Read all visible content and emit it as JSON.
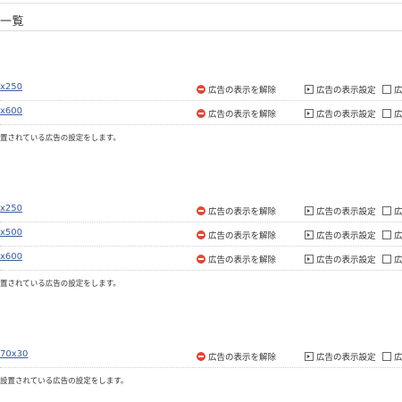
{
  "page": {
    "title": "一覧"
  },
  "actions": {
    "remove_label": "広告の表示を解除",
    "settings_label": "広告の表示設定",
    "more_label": "広告"
  },
  "groups": [
    {
      "rows": [
        {
          "size": "x250"
        },
        {
          "size": "x600"
        }
      ],
      "note": "置されている広告の設定をします。"
    },
    {
      "rows": [
        {
          "size": "x250"
        },
        {
          "size": "x500"
        },
        {
          "size": "x600"
        }
      ],
      "note": "置されている広告の設定をします。"
    },
    {
      "rows": [
        {
          "size": "70x30"
        }
      ],
      "note": "設置されている広告の設定をします。"
    }
  ],
  "colors": {
    "link": "#3a5a9c",
    "remove_icon": "#e04a3a"
  }
}
